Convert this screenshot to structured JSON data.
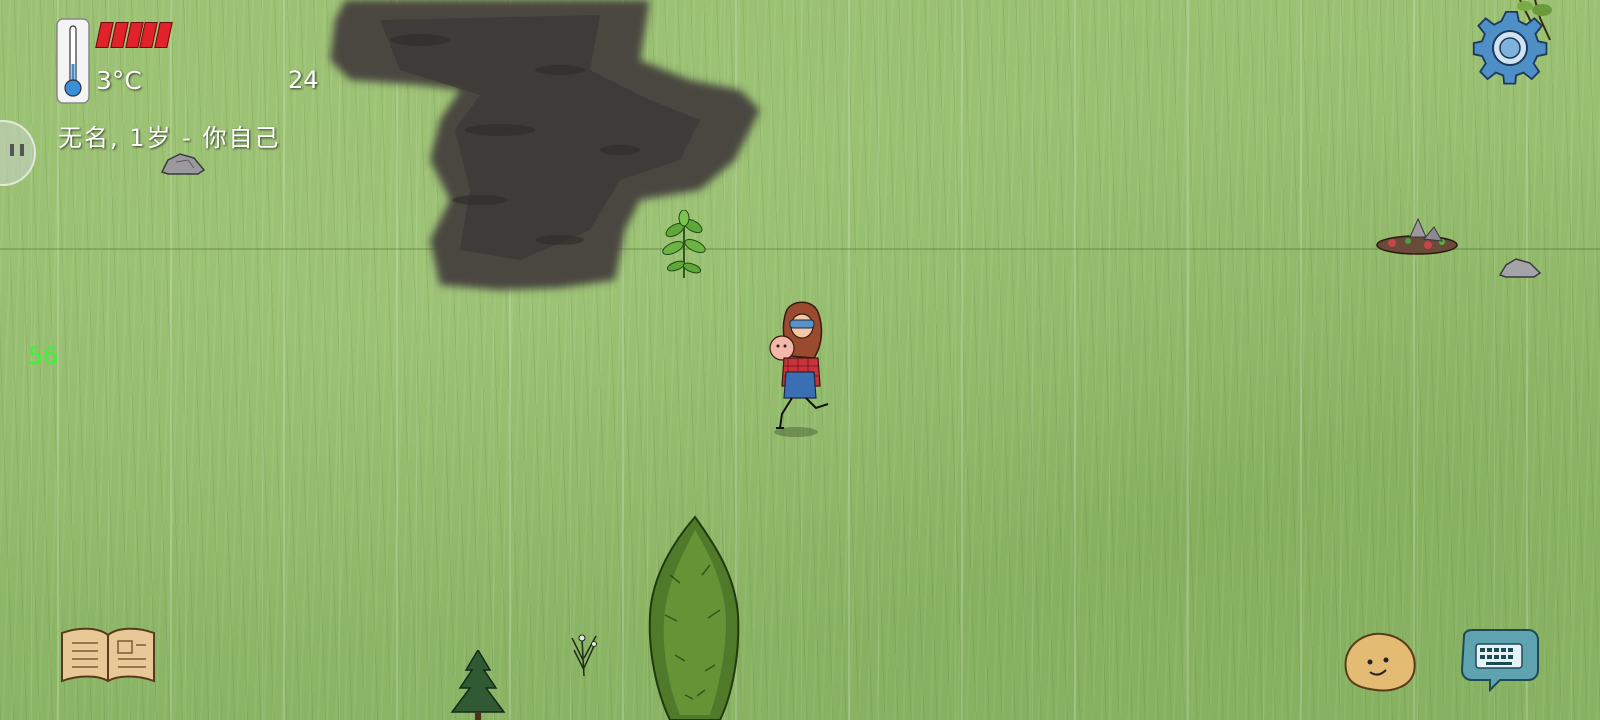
{
  "hud": {
    "temperature": "3°C",
    "yum_counter": "24",
    "player_label": "无名, 1岁 - 你自己",
    "fps": "56",
    "food_pips": 5
  },
  "icons": {
    "thermometer": "thermometer-icon",
    "settings": "gear-icon",
    "tech_book": "book-icon",
    "emote": "emote-face-icon",
    "chat": "keyboard-chat-icon",
    "side_menu": "pause-icon"
  },
  "colors": {
    "food_bar": "#e0232a",
    "fps_text": "#3ef23a",
    "grass": "#93bb6c",
    "hud_text": "#ffffff"
  }
}
